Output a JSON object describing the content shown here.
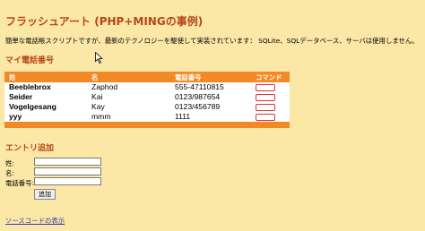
{
  "page": {
    "title": "フラッシュアート (PHP+MINGの事例)",
    "description": "簡単な電話帳スクリプトですが、最新のテクノロジーを駆使して実装されています： SQLite、SQLデータベース、サーバは使用しません。"
  },
  "phonebook": {
    "heading": "マイ電話番号",
    "columns": [
      "姓",
      "名",
      "電話番号",
      "コマンド"
    ],
    "rows": [
      {
        "last": "Beeblebrox",
        "first": "Zaphod",
        "phone": "555-47110815"
      },
      {
        "last": "Seider",
        "first": "Kai",
        "phone": "0123/987654"
      },
      {
        "last": "Vogelgesang",
        "first": "Kay",
        "phone": "0123/456789"
      },
      {
        "last": "yyy",
        "first": "mmm",
        "phone": "1111"
      }
    ]
  },
  "entry_form": {
    "heading": "エントリ追加",
    "last_label": "姓:",
    "first_label": "名:",
    "phone_label": "電話番号:",
    "last_value": "",
    "first_value": "",
    "phone_value": "",
    "submit_label": "追加"
  },
  "footer": {
    "source_link": "ソースコードの表示"
  },
  "colors": {
    "background": "#fbe7a6",
    "accent": "#f18a25",
    "heading": "#b5471a"
  }
}
